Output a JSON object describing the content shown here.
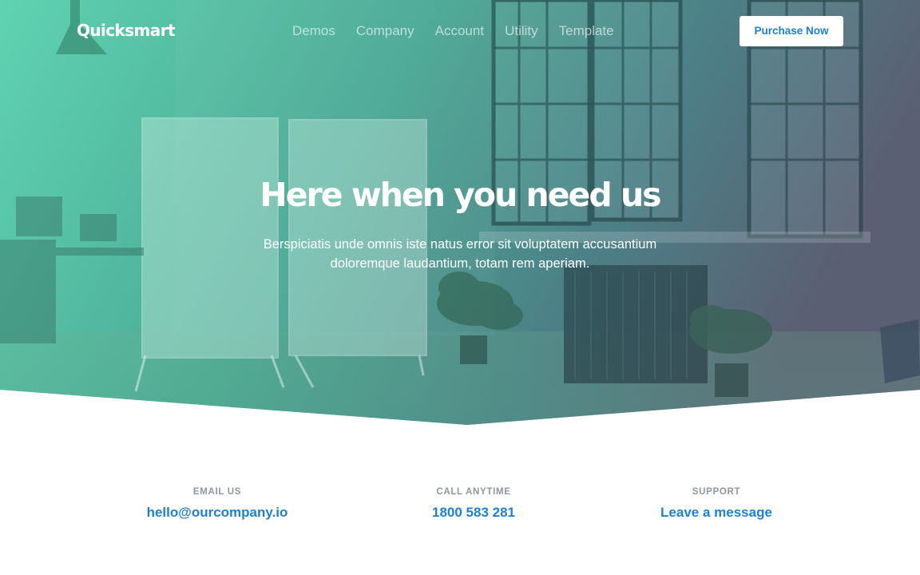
{
  "brand": {
    "logo_text": "Quicksmart"
  },
  "nav": {
    "items": [
      {
        "label": "Demos"
      },
      {
        "label": "Company"
      },
      {
        "label": "Account"
      },
      {
        "label": "Utility"
      },
      {
        "label": "Template"
      }
    ],
    "cta_label": "Purchase Now"
  },
  "hero": {
    "headline": "Here when you need us",
    "subtext": "Berspiciatis unde omnis iste natus error sit voluptatem accusantium doloremque laudantium, totam rem aperiam.",
    "gradient_start": "#5ccfae",
    "gradient_end": "#5a6478"
  },
  "contact": {
    "items": [
      {
        "label": "EMAIL US",
        "value": "hello@ourcompany.io"
      },
      {
        "label": "CALL ANYTIME",
        "value": "1800 583 281"
      },
      {
        "label": "SUPPORT",
        "value": "Leave a message"
      }
    ]
  },
  "colors": {
    "accent": "#1e7fd6",
    "label_grey": "#8f979e"
  }
}
